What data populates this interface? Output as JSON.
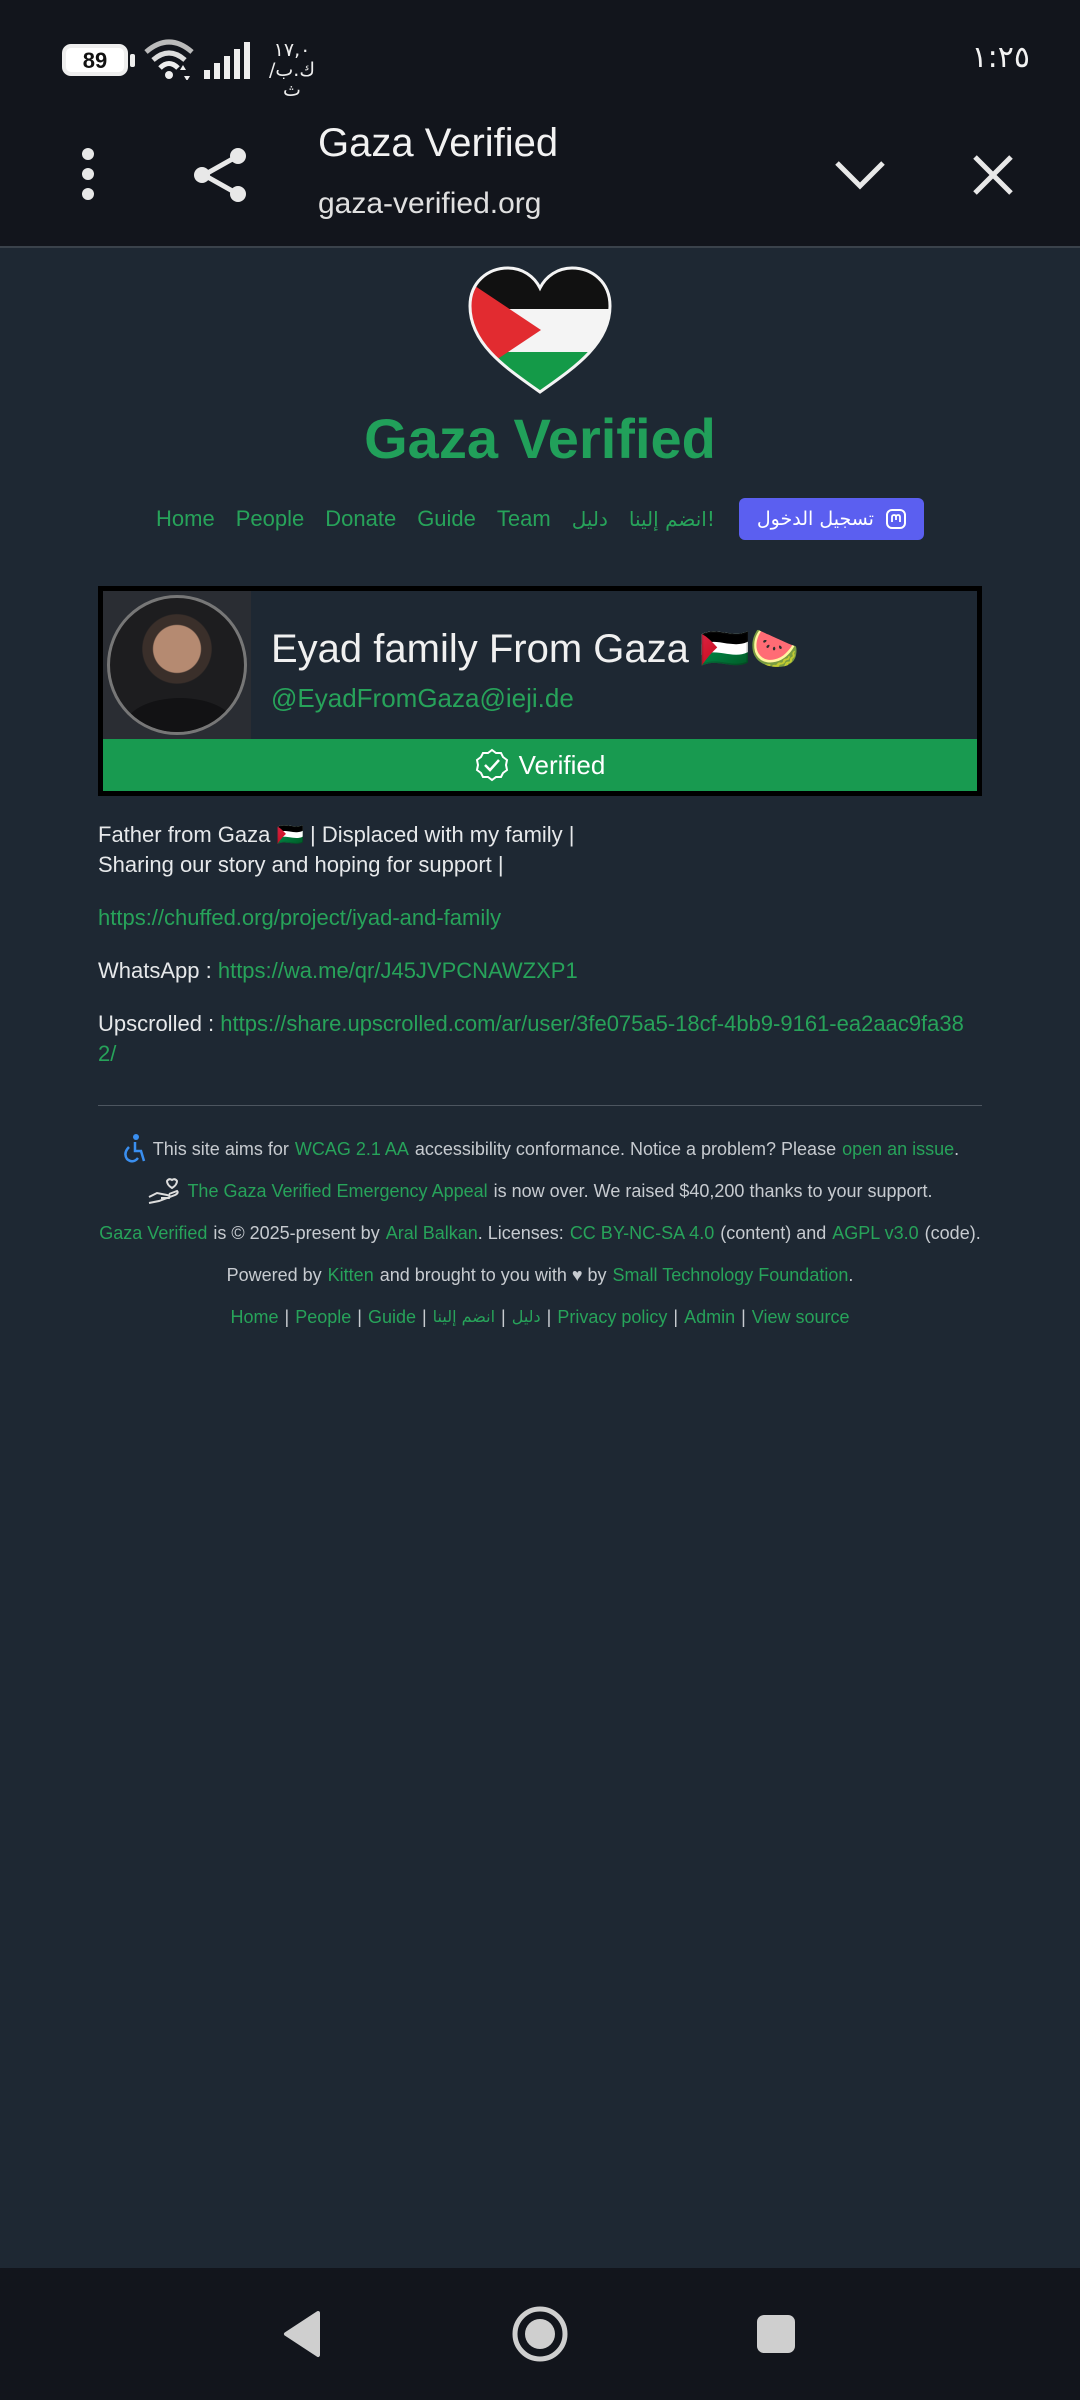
{
  "status_bar": {
    "battery": "89",
    "speed_top": "١٧,٠",
    "speed_unit": "ك.ب/ث",
    "time": "١:٢٥"
  },
  "browser": {
    "title": "Gaza Verified",
    "url": "gaza-verified.org",
    "icons": [
      "more-vert-icon",
      "share-icon",
      "chevron-down-icon",
      "close-icon"
    ]
  },
  "site": {
    "title": "Gaza Verified",
    "nav": {
      "home": "Home",
      "people": "People",
      "donate": "Donate",
      "guide": "Guide",
      "team": "Team",
      "guide_ar": "دليل",
      "join_ar": "انضم إلينا!",
      "login": "تسجيل الدخول"
    }
  },
  "profile": {
    "name": "Eyad family From Gaza 🇵🇸🍉",
    "handle": "@EyadFromGaza@ieji.de",
    "verified": "Verified"
  },
  "bio": {
    "line1": "Father from Gaza 🇵🇸 | Displaced with my family |",
    "line2": "Sharing our story and hoping for support |",
    "link1": "https://chuffed.org/project/iyad-and-family",
    "whatsapp_label": "WhatsApp : ",
    "whatsapp_link": "https://wa.me/qr/J45JVPCNAWZXP1",
    "upscrolled_label": "Upscrolled : ",
    "upscrolled_link": "https://share.upscrolled.com/ar/user/3fe075a5-18cf-4bb9-9161-ea2aac9fa382/"
  },
  "footer": {
    "l1_pre": "This site aims for",
    "l1_link": "WCAG 2.1 AA",
    "l1_mid": "accessibility conformance. Notice a problem? Please",
    "l1_link2": "open an issue",
    "l1_end": ".",
    "l2_link": "The Gaza Verified Emergency Appeal",
    "l2_text": "is now over. We raised $40,200 thanks to your support.",
    "l3_link1": "Gaza Verified",
    "l3_t1": "is © 2025-present by",
    "l3_link2": "Aral Balkan",
    "l3_t2": ". Licenses:",
    "l3_link3": "CC BY-NC-SA 4.0",
    "l3_t3": "(content) and",
    "l3_link4": "AGPL v3.0",
    "l3_t4": "(code).",
    "l4_t1": "Powered by",
    "l4_link1": "Kitten",
    "l4_t2": "and brought to you with ♥ by",
    "l4_link2": "Small Technology Foundation",
    "l4_t3": ".",
    "links": {
      "home": "Home",
      "people": "People",
      "guide": "Guide",
      "join_ar": "انضم إلينا",
      "guide_ar": "دليل",
      "privacy": "Privacy policy",
      "admin": "Admin",
      "source": "View source",
      "sep": "|"
    }
  },
  "colors": {
    "accent_green": "#27a35a",
    "verified_bar": "#189a50",
    "login_button": "#5b5ff0",
    "background": "#1e2833"
  }
}
